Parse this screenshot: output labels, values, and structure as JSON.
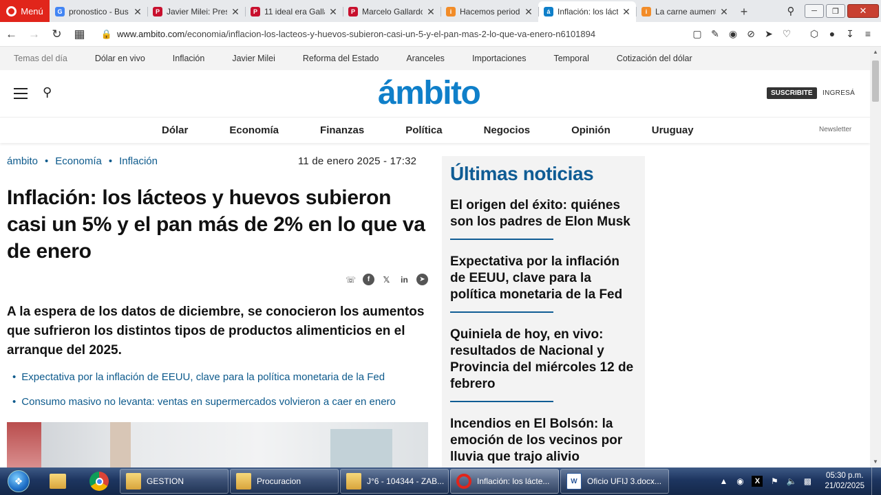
{
  "browser": {
    "menu_label": "Menú",
    "tabs": [
      {
        "label": "pronostico - Bus",
        "favicon": "google-icon",
        "color": "#4285f4",
        "glyph": "G"
      },
      {
        "label": "Javier Milei: Pres",
        "favicon": "perfil-icon",
        "color": "#c8102e",
        "glyph": "P"
      },
      {
        "label": "11 ideal era Galla",
        "favicon": "perfil-icon",
        "color": "#c8102e",
        "glyph": "P"
      },
      {
        "label": "Marcelo Gallardo",
        "favicon": "perfil-icon",
        "color": "#c8102e",
        "glyph": "P"
      },
      {
        "label": "Hacemos period",
        "favicon": "infobae-icon",
        "color": "#f28c28",
        "glyph": "i"
      },
      {
        "label": "Inflación: los láct",
        "favicon": "ambito-icon",
        "color": "#0f7fc9",
        "glyph": "á",
        "active": true
      },
      {
        "label": "La carne aument",
        "favicon": "infobae-icon",
        "color": "#f28c28",
        "glyph": "i"
      }
    ],
    "url_host": "www.ambito.com",
    "url_path": "/economia/inflacion-los-lacteos-y-huevos-subieron-casi-un-5-y-el-pan-mas-2-lo-que-va-enero-n6101894"
  },
  "site": {
    "topics": [
      "Temas del día",
      "Dólar en vivo",
      "Inflación",
      "Javier Milei",
      "Reforma del Estado",
      "Aranceles",
      "Importaciones",
      "Temporal",
      "Cotización del dólar"
    ],
    "logo": "ámbito",
    "subscribe_label": "SUSCRIBITE",
    "login_label": "INGRESÁ",
    "sections": [
      "Dólar",
      "Economía",
      "Finanzas",
      "Política",
      "Negocios",
      "Opinión",
      "Uruguay"
    ],
    "newsletter_label": "Newsletter",
    "brand_color": "#0f7fc9"
  },
  "article": {
    "breadcrumb": [
      "ámbito",
      "Economía",
      "Inflación"
    ],
    "breadcrumb_sep": "•",
    "date": "11 de enero 2025 - 17:32",
    "headline": "Inflación: los lácteos y huevos subieron casi un 5% y el pan más de 2% en lo que va de enero",
    "lead": "A la espera de los datos de diciembre, se conocieron los aumentos que sufrieron los distintos tipos de productos alimenticios en el arranque del 2025.",
    "related": [
      "Expectativa por la inflación de EEUU, clave para la política monetaria de la Fed",
      "Consumo masivo no levanta: ventas en supermercados volvieron a caer en enero"
    ]
  },
  "sidebar": {
    "title": "Últimas noticias",
    "items": [
      "El origen del éxito: quiénes son los padres de Elon Musk",
      "Expectativa por la inflación de EEUU, clave para la política monetaria de la Fed",
      "Quiniela de hoy, en vivo: resultados de Nacional y Provincia del miércoles 12 de febrero",
      "Incendios en El Bolsón: la emoción de los vecinos por lluvia que trajo alivio"
    ]
  },
  "taskbar": {
    "tasks": [
      {
        "label": "GESTION",
        "icon": "folder"
      },
      {
        "label": "Procuracion",
        "icon": "folder"
      },
      {
        "label": "J°6 - 104344 - ZAB...",
        "icon": "folder"
      },
      {
        "label": "Inflación: los lácte...",
        "icon": "opera",
        "active": true
      },
      {
        "label": "Oficio UFIJ 3.docx...",
        "icon": "word"
      }
    ],
    "time": "05:30 p.m.",
    "date": "21/02/2025"
  }
}
